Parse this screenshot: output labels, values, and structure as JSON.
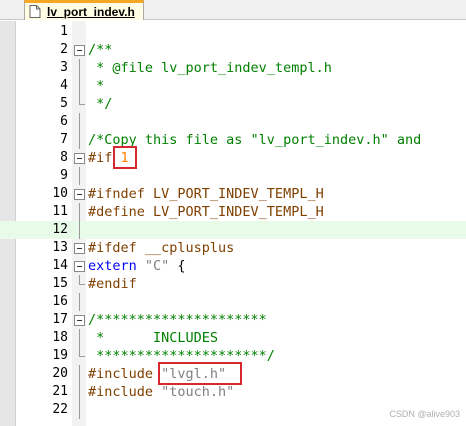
{
  "tab": {
    "label": "lv_port_indev.h",
    "icon": "file-icon"
  },
  "lines": [
    {
      "n": "1",
      "segs": []
    },
    {
      "n": "2",
      "segs": [
        {
          "t": "/**",
          "c": "cm"
        }
      ]
    },
    {
      "n": "3",
      "segs": [
        {
          "t": " * @file lv_port_indev_templ.h",
          "c": "cm"
        }
      ]
    },
    {
      "n": "4",
      "segs": [
        {
          "t": " *",
          "c": "cm"
        }
      ]
    },
    {
      "n": "5",
      "segs": [
        {
          "t": " */",
          "c": "cm"
        }
      ]
    },
    {
      "n": "6",
      "segs": []
    },
    {
      "n": "7",
      "segs": [
        {
          "t": "/*Copy this file as \"lv_port_indev.h\" and",
          "c": "cm"
        }
      ]
    },
    {
      "n": "8",
      "segs": [
        {
          "t": "#if ",
          "c": "pp"
        },
        {
          "t": "1",
          "c": "num"
        }
      ]
    },
    {
      "n": "9",
      "segs": []
    },
    {
      "n": "10",
      "segs": [
        {
          "t": "#ifndef LV_PORT_INDEV_TEMPL_H",
          "c": "pp"
        }
      ]
    },
    {
      "n": "11",
      "segs": [
        {
          "t": "#define LV_PORT_INDEV_TEMPL_H",
          "c": "pp"
        }
      ]
    },
    {
      "n": "12",
      "segs": []
    },
    {
      "n": "13",
      "segs": [
        {
          "t": "#ifdef __cplusplus",
          "c": "pp"
        }
      ]
    },
    {
      "n": "14",
      "segs": [
        {
          "t": "extern ",
          "c": "kw"
        },
        {
          "t": "\"C\" ",
          "c": "str"
        },
        {
          "t": "{",
          "c": ""
        }
      ]
    },
    {
      "n": "15",
      "segs": [
        {
          "t": "#endif",
          "c": "pp"
        }
      ]
    },
    {
      "n": "16",
      "segs": []
    },
    {
      "n": "17",
      "segs": [
        {
          "t": "/*********************",
          "c": "cm"
        }
      ]
    },
    {
      "n": "18",
      "segs": [
        {
          "t": " *      INCLUDES",
          "c": "cm"
        }
      ]
    },
    {
      "n": "19",
      "segs": [
        {
          "t": " *********************/",
          "c": "cm"
        }
      ]
    },
    {
      "n": "20",
      "segs": [
        {
          "t": "#include ",
          "c": "pp"
        },
        {
          "t": "\"lvgl.h\"",
          "c": "str"
        }
      ]
    },
    {
      "n": "21",
      "segs": [
        {
          "t": "#include ",
          "c": "pp"
        },
        {
          "t": "\"touch.h\"",
          "c": "str"
        }
      ]
    },
    {
      "n": "22",
      "segs": []
    }
  ],
  "highlighted_line": "12",
  "watermark": "CSDN @alive903",
  "colors": {
    "comment": "#008000",
    "preprocessor": "#804000",
    "keyword": "#0000ff",
    "string": "#808080",
    "number": "#ff8000",
    "annotation_box": "#d6282e",
    "current_line": "#e8fbe8"
  }
}
